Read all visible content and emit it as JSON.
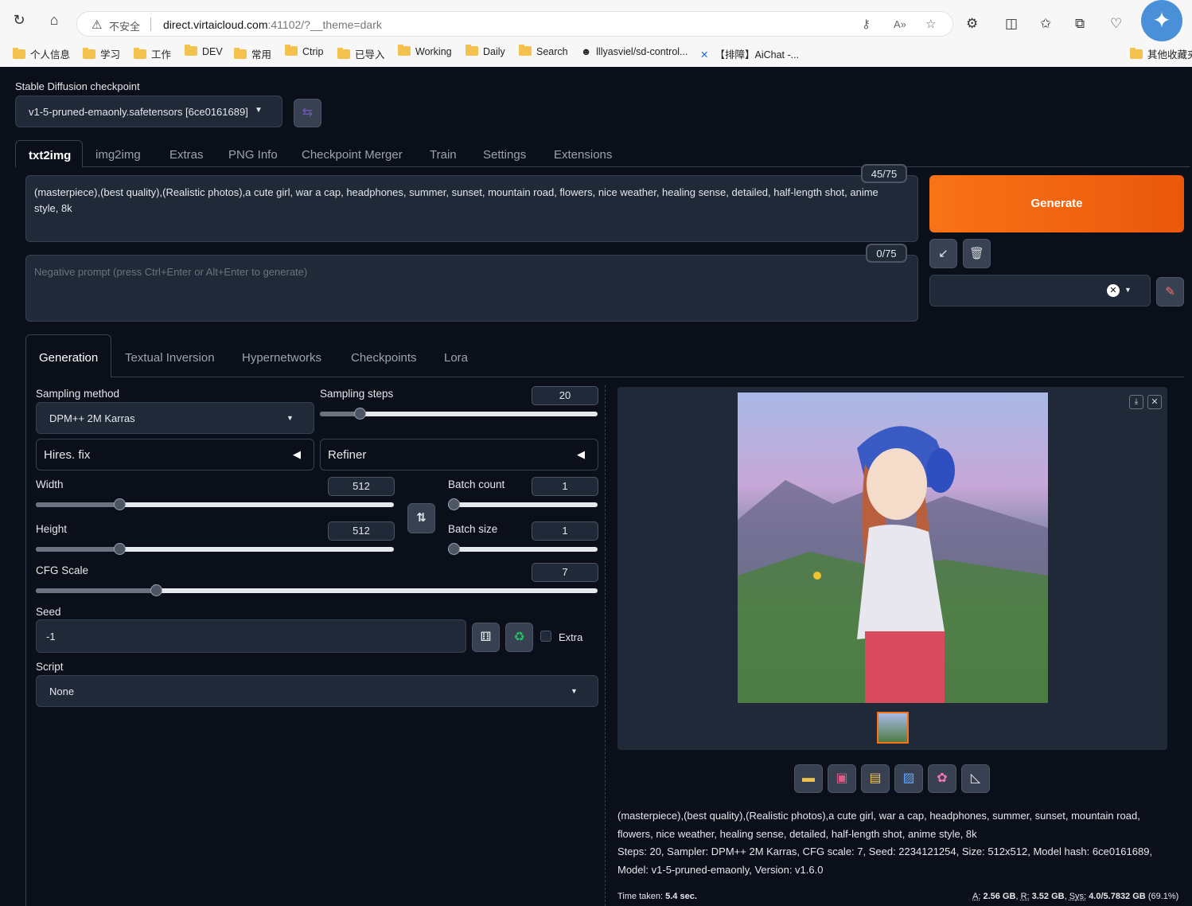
{
  "browser": {
    "insecure_label": "不安全",
    "url_host": "direct.virtaicloud.com",
    "url_rest": ":41102/?__theme=dark",
    "bookmarks": [
      "个人信息",
      "学习",
      "工作",
      "DEV",
      "常用",
      "Ctrip",
      "已导入",
      "Working",
      "Daily",
      "Search",
      "lllyasviel/sd-control...",
      "【排障】AiChat -...",
      "其他收藏夹"
    ]
  },
  "checkpoint": {
    "label": "Stable Diffusion checkpoint",
    "value": "v1-5-pruned-emaonly.safetensors [6ce0161689]"
  },
  "main_tabs": [
    "txt2img",
    "img2img",
    "Extras",
    "PNG Info",
    "Checkpoint Merger",
    "Train",
    "Settings",
    "Extensions"
  ],
  "prompt": {
    "text": "(masterpiece),(best quality),(Realistic photos),a cute girl, war a cap, headphones, summer, sunset, mountain road, flowers, nice weather, healing sense, detailed, half-length shot, anime style, 8k",
    "token_count": "45/75"
  },
  "negative_prompt": {
    "placeholder": "Negative prompt (press Ctrl+Enter or Alt+Enter to generate)",
    "token_count": "0/75"
  },
  "generate_label": "Generate",
  "sub_tabs": [
    "Generation",
    "Textual Inversion",
    "Hypernetworks",
    "Checkpoints",
    "Lora"
  ],
  "params": {
    "sampling_method_label": "Sampling method",
    "sampling_method": "DPM++ 2M Karras",
    "sampling_steps_label": "Sampling steps",
    "sampling_steps": "20",
    "hires_label": "Hires. fix",
    "refiner_label": "Refiner",
    "width_label": "Width",
    "width": "512",
    "height_label": "Height",
    "height": "512",
    "batch_count_label": "Batch count",
    "batch_count": "1",
    "batch_size_label": "Batch size",
    "batch_size": "1",
    "cfg_label": "CFG Scale",
    "cfg": "7",
    "seed_label": "Seed",
    "seed": "-1",
    "extra_label": "Extra",
    "script_label": "Script",
    "script": "None"
  },
  "output": {
    "info_prompt": "(masterpiece),(best quality),(Realistic photos),a cute girl, war a cap, headphones, summer, sunset, mountain road, flowers, nice weather, healing sense, detailed, half-length shot, anime style, 8k",
    "info_params": "Steps: 20, Sampler: DPM++ 2M Karras, CFG scale: 7, Seed: 2234121254, Size: 512x512, Model hash: 6ce0161689, Model: v1-5-pruned-emaonly, Version: v1.6.0",
    "time_label": "Time taken:",
    "time_value": "5.4 sec.",
    "mem_a_label": "A:",
    "mem_a": "2.56 GB",
    "mem_r_label": "R:",
    "mem_r": "3.52 GB",
    "mem_sys_label": "Sys:",
    "mem_sys": "4.0/5.7832 GB",
    "mem_pct": "(69.1%)"
  },
  "colors": {
    "generate": "#f97316",
    "accent": "#f97316",
    "bg": "#0b0f19",
    "panel": "#1f2937"
  }
}
